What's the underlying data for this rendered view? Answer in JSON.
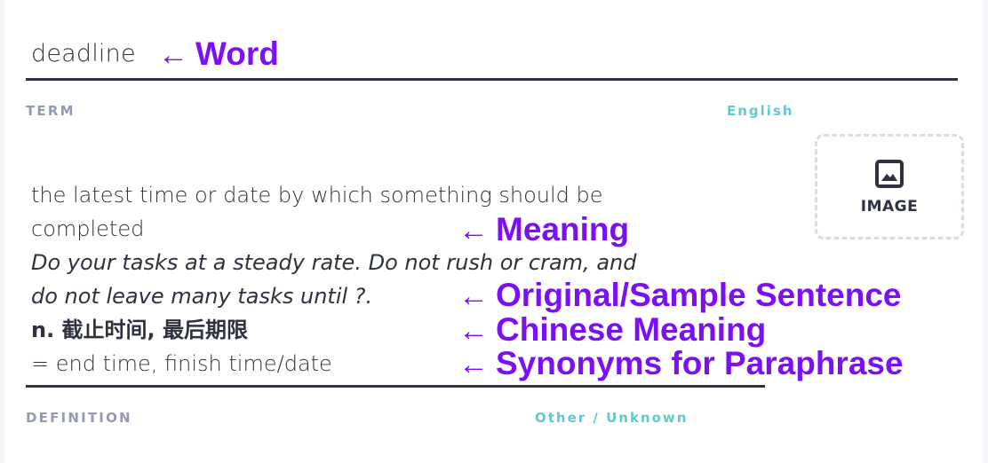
{
  "term": {
    "value": "deadline",
    "label": "TERM",
    "language": "English"
  },
  "definition": {
    "meaning_lines": [
      "the latest time or date by which something should be",
      "completed"
    ],
    "sample_lines": [
      "Do your tasks at a steady rate. Do not rush or cram, and",
      "do not leave many tasks until ?."
    ],
    "chinese": "n. 截止时间, 最后期限",
    "synonyms": "= end time, finish time/date",
    "label": "DEFINITION",
    "language": "Other / Unknown"
  },
  "image_button": {
    "label": "IMAGE",
    "icon": "image-icon"
  },
  "annotations": {
    "arrow": "←",
    "word": "Word",
    "meaning": "Meaning",
    "sample": "Original/Sample Sentence",
    "chinese": "Chinese Meaning",
    "synonyms": "Synonyms for Paraphrase",
    "color": "#7b10f5"
  },
  "colors": {
    "text": "#2e3140",
    "label": "#939bb4",
    "language": "#5fcbcf",
    "dashed_border": "#d9dce6"
  }
}
